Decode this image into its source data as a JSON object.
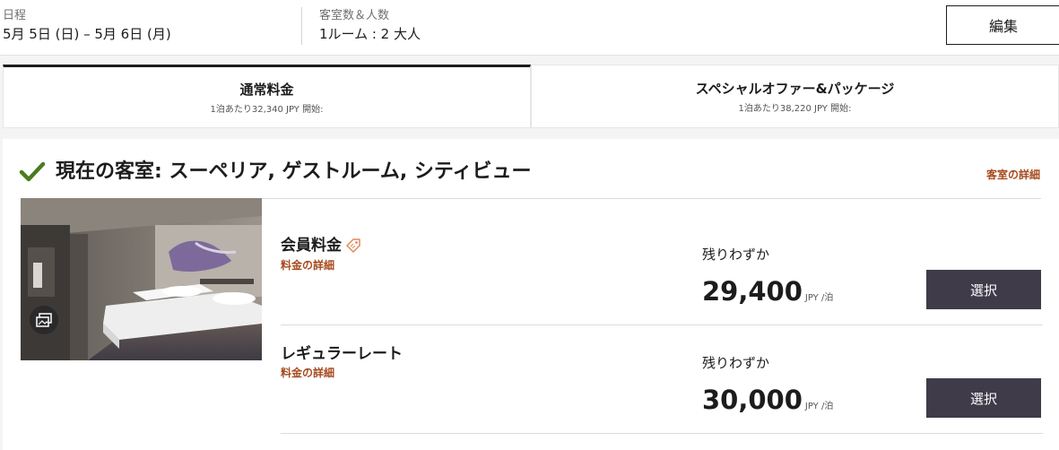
{
  "summary": {
    "dates_label": "日程",
    "dates_value": "5月 5日 (日) – 5月 6日 (月)",
    "rooms_label": "客室数＆人数",
    "rooms_value": "1ルーム : 2 大人",
    "edit_label": "編集"
  },
  "tabs": [
    {
      "title": "通常料金",
      "subtitle": "1泊あたり32,340 JPY 開始:",
      "active": true
    },
    {
      "title": "スペシャルオファー&パッケージ",
      "subtitle": "1泊あたり38,220 JPY 開始:",
      "active": false
    }
  ],
  "room": {
    "title": "現在の客室: スーペリア, ゲストルーム, シティビュー",
    "detail_link": "客室の詳細",
    "icons": {
      "selected": "checkmark-icon",
      "gallery": "gallery-icon"
    },
    "rates": [
      {
        "name": "会員料金",
        "name_icon": "tag-icon",
        "detail_link": "料金の詳細",
        "availability": "残りわずか",
        "price": "29,400",
        "per_night": "JPY /泊",
        "select_label": "選択"
      },
      {
        "name": "レギュラーレート",
        "detail_link": "料金の詳細",
        "availability": "残りわずか",
        "price": "30,000",
        "per_night": "JPY /泊",
        "select_label": "選択"
      }
    ]
  },
  "colors": {
    "accent_link": "#a64b1f",
    "button_dark": "#3f3b49",
    "check_green": "#4a7c1f",
    "tag_orange": "#e08a5a"
  }
}
